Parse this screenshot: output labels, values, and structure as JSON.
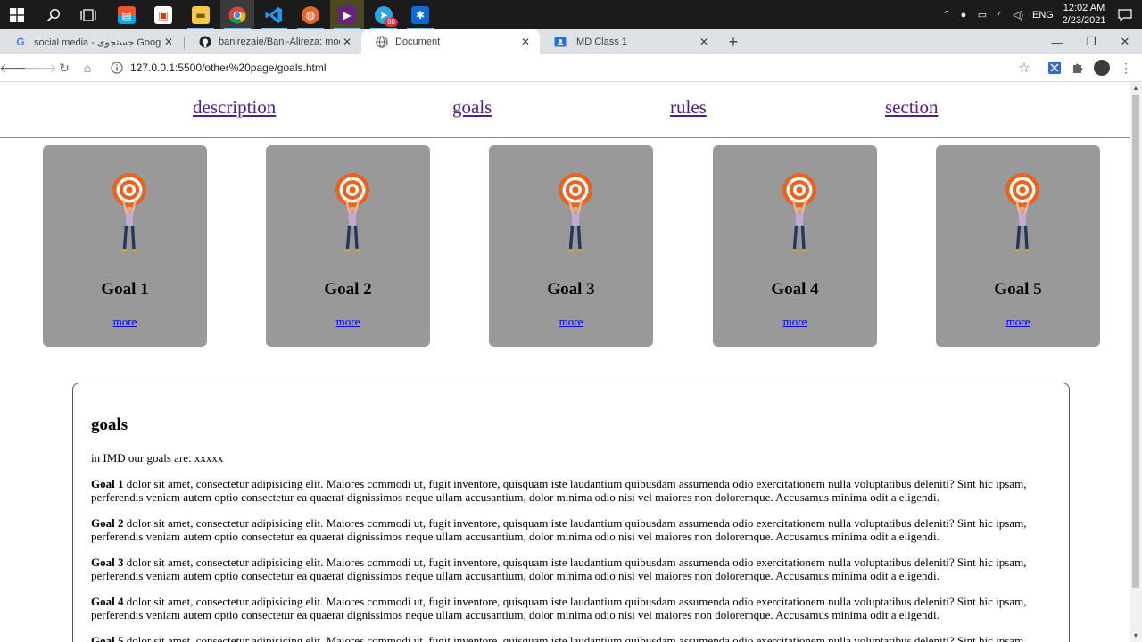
{
  "taskbar": {
    "clock_time": "12:02 AM",
    "clock_date": "2/23/2021",
    "language": "ENG",
    "telegram_badge": "80"
  },
  "tabs": [
    {
      "title": "social media - جستجوی Google"
    },
    {
      "title": "banirezaie/Bani-Alireza: mock-htm"
    },
    {
      "title": "Document"
    },
    {
      "title": "IMD Class 1"
    }
  ],
  "address_bar": {
    "url": "127.0.0.1:5500/other%20page/goals.html"
  },
  "site_nav": {
    "links": [
      "description",
      "goals",
      "rules",
      "section"
    ]
  },
  "cards": [
    {
      "title": "Goal 1",
      "link": "more"
    },
    {
      "title": "Goal 2",
      "link": "more"
    },
    {
      "title": "Goal 3",
      "link": "more"
    },
    {
      "title": "Goal 4",
      "link": "more"
    },
    {
      "title": "Goal 5",
      "link": "more"
    }
  ],
  "goals_section": {
    "heading": "goals",
    "intro": "in IMD our goals are: xxxxx",
    "paragraphs": [
      {
        "label": "Goal 1",
        "text": " dolor sit amet, consectetur adipisicing elit. Maiores commodi ut, fugit inventore, quisquam iste laudantium quibusdam assumenda odio exercitationem nulla voluptatibus deleniti? Sint hic ipsam, perferendis veniam autem optio consectetur ea quaerat dignissimos neque ullam accusantium, dolor minima odio nisi vel maiores non doloremque. Accusamus minima odit a eligendi."
      },
      {
        "label": "Goal 2",
        "text": " dolor sit amet, consectetur adipisicing elit. Maiores commodi ut, fugit inventore, quisquam iste laudantium quibusdam assumenda odio exercitationem nulla voluptatibus deleniti? Sint hic ipsam, perferendis veniam autem optio consectetur ea quaerat dignissimos neque ullam accusantium, dolor minima odio nisi vel maiores non doloremque. Accusamus minima odit a eligendi."
      },
      {
        "label": "Goal 3",
        "text": " dolor sit amet, consectetur adipisicing elit. Maiores commodi ut, fugit inventore, quisquam iste laudantium quibusdam assumenda odio exercitationem nulla voluptatibus deleniti? Sint hic ipsam, perferendis veniam autem optio consectetur ea quaerat dignissimos neque ullam accusantium, dolor minima odio nisi vel maiores non doloremque. Accusamus minima odit a eligendi."
      },
      {
        "label": "Goal 4",
        "text": " dolor sit amet, consectetur adipisicing elit. Maiores commodi ut, fugit inventore, quisquam iste laudantium quibusdam assumenda odio exercitationem nulla voluptatibus deleniti? Sint hic ipsam, perferendis veniam autem optio consectetur ea quaerat dignissimos neque ullam accusantium, dolor minima odio nisi vel maiores non doloremque. Accusamus minima odit a eligendi."
      },
      {
        "label": "Goal 5",
        "text": " dolor sit amet, consectetur adipisicing elit. Maiores commodi ut, fugit inventore, quisquam iste laudantium quibusdam assumenda odio exercitationem nulla voluptatibus deleniti? Sint hic ipsam,"
      }
    ]
  },
  "colors": {
    "card_bg": "#999999",
    "visited_link": "#551a8b",
    "link": "#0000ee",
    "target_orange": "#e8631c"
  }
}
